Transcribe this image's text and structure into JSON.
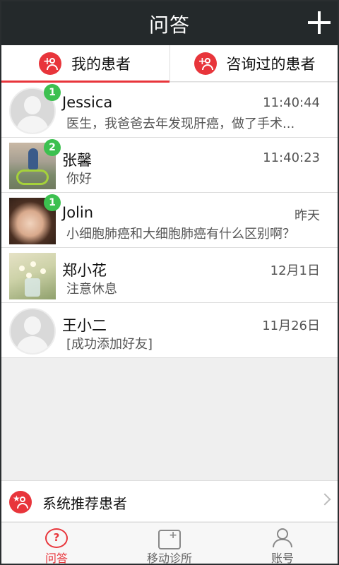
{
  "header": {
    "title": "问答"
  },
  "tabs": [
    {
      "label": "我的患者",
      "active": true
    },
    {
      "label": "咨询过的患者",
      "active": false
    }
  ],
  "conversations": [
    {
      "name": "Jessica",
      "time": "11:40:44",
      "message": "医生，我爸爸去年发现肝癌，做了手术...",
      "badge": "1",
      "avatar": "default-avatar"
    },
    {
      "name": "张馨",
      "time": "11:40:23",
      "message": "你好",
      "badge": "2",
      "avatar": "photo-kid-bike"
    },
    {
      "name": "Jolin",
      "time": "昨天",
      "message": "小细胞肺癌和大细胞肺癌有什么区别啊？",
      "badge": "1",
      "avatar": "photo-girl"
    },
    {
      "name": "郑小花",
      "time": "12月1日",
      "message": "注意休息",
      "badge": "",
      "avatar": "photo-flowers"
    },
    {
      "name": "王小二",
      "time": "11月26日",
      "message": "[成功添加好友]",
      "badge": "",
      "avatar": "default-avatar"
    }
  ],
  "recommend": {
    "label": "系统推荐患者"
  },
  "bottom_nav": [
    {
      "label": "问答",
      "active": true
    },
    {
      "label": "移动诊所",
      "active": false
    },
    {
      "label": "账号",
      "active": false
    }
  ],
  "colors": {
    "accent": "#e8353b",
    "topbar": "#24292b",
    "badge": "#3cc04f"
  }
}
